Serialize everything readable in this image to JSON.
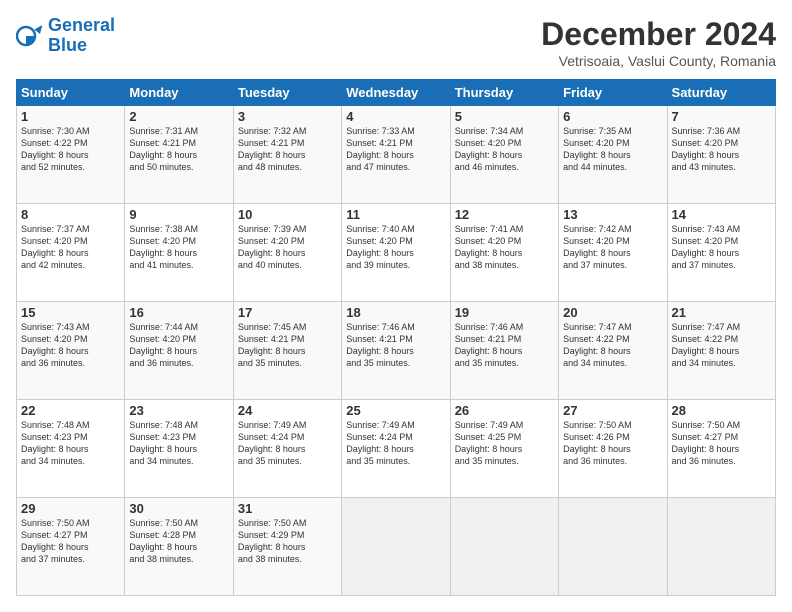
{
  "logo": {
    "line1": "General",
    "line2": "Blue"
  },
  "title": "December 2024",
  "location": "Vetrisoaia, Vaslui County, Romania",
  "days_of_week": [
    "Sunday",
    "Monday",
    "Tuesday",
    "Wednesday",
    "Thursday",
    "Friday",
    "Saturday"
  ],
  "weeks": [
    [
      {
        "day": "1",
        "lines": [
          "Sunrise: 7:30 AM",
          "Sunset: 4:22 PM",
          "Daylight: 8 hours",
          "and 52 minutes."
        ]
      },
      {
        "day": "2",
        "lines": [
          "Sunrise: 7:31 AM",
          "Sunset: 4:21 PM",
          "Daylight: 8 hours",
          "and 50 minutes."
        ]
      },
      {
        "day": "3",
        "lines": [
          "Sunrise: 7:32 AM",
          "Sunset: 4:21 PM",
          "Daylight: 8 hours",
          "and 48 minutes."
        ]
      },
      {
        "day": "4",
        "lines": [
          "Sunrise: 7:33 AM",
          "Sunset: 4:21 PM",
          "Daylight: 8 hours",
          "and 47 minutes."
        ]
      },
      {
        "day": "5",
        "lines": [
          "Sunrise: 7:34 AM",
          "Sunset: 4:20 PM",
          "Daylight: 8 hours",
          "and 46 minutes."
        ]
      },
      {
        "day": "6",
        "lines": [
          "Sunrise: 7:35 AM",
          "Sunset: 4:20 PM",
          "Daylight: 8 hours",
          "and 44 minutes."
        ]
      },
      {
        "day": "7",
        "lines": [
          "Sunrise: 7:36 AM",
          "Sunset: 4:20 PM",
          "Daylight: 8 hours",
          "and 43 minutes."
        ]
      }
    ],
    [
      {
        "day": "8",
        "lines": [
          "Sunrise: 7:37 AM",
          "Sunset: 4:20 PM",
          "Daylight: 8 hours",
          "and 42 minutes."
        ]
      },
      {
        "day": "9",
        "lines": [
          "Sunrise: 7:38 AM",
          "Sunset: 4:20 PM",
          "Daylight: 8 hours",
          "and 41 minutes."
        ]
      },
      {
        "day": "10",
        "lines": [
          "Sunrise: 7:39 AM",
          "Sunset: 4:20 PM",
          "Daylight: 8 hours",
          "and 40 minutes."
        ]
      },
      {
        "day": "11",
        "lines": [
          "Sunrise: 7:40 AM",
          "Sunset: 4:20 PM",
          "Daylight: 8 hours",
          "and 39 minutes."
        ]
      },
      {
        "day": "12",
        "lines": [
          "Sunrise: 7:41 AM",
          "Sunset: 4:20 PM",
          "Daylight: 8 hours",
          "and 38 minutes."
        ]
      },
      {
        "day": "13",
        "lines": [
          "Sunrise: 7:42 AM",
          "Sunset: 4:20 PM",
          "Daylight: 8 hours",
          "and 37 minutes."
        ]
      },
      {
        "day": "14",
        "lines": [
          "Sunrise: 7:43 AM",
          "Sunset: 4:20 PM",
          "Daylight: 8 hours",
          "and 37 minutes."
        ]
      }
    ],
    [
      {
        "day": "15",
        "lines": [
          "Sunrise: 7:43 AM",
          "Sunset: 4:20 PM",
          "Daylight: 8 hours",
          "and 36 minutes."
        ]
      },
      {
        "day": "16",
        "lines": [
          "Sunrise: 7:44 AM",
          "Sunset: 4:20 PM",
          "Daylight: 8 hours",
          "and 36 minutes."
        ]
      },
      {
        "day": "17",
        "lines": [
          "Sunrise: 7:45 AM",
          "Sunset: 4:21 PM",
          "Daylight: 8 hours",
          "and 35 minutes."
        ]
      },
      {
        "day": "18",
        "lines": [
          "Sunrise: 7:46 AM",
          "Sunset: 4:21 PM",
          "Daylight: 8 hours",
          "and 35 minutes."
        ]
      },
      {
        "day": "19",
        "lines": [
          "Sunrise: 7:46 AM",
          "Sunset: 4:21 PM",
          "Daylight: 8 hours",
          "and 35 minutes."
        ]
      },
      {
        "day": "20",
        "lines": [
          "Sunrise: 7:47 AM",
          "Sunset: 4:22 PM",
          "Daylight: 8 hours",
          "and 34 minutes."
        ]
      },
      {
        "day": "21",
        "lines": [
          "Sunrise: 7:47 AM",
          "Sunset: 4:22 PM",
          "Daylight: 8 hours",
          "and 34 minutes."
        ]
      }
    ],
    [
      {
        "day": "22",
        "lines": [
          "Sunrise: 7:48 AM",
          "Sunset: 4:23 PM",
          "Daylight: 8 hours",
          "and 34 minutes."
        ]
      },
      {
        "day": "23",
        "lines": [
          "Sunrise: 7:48 AM",
          "Sunset: 4:23 PM",
          "Daylight: 8 hours",
          "and 34 minutes."
        ]
      },
      {
        "day": "24",
        "lines": [
          "Sunrise: 7:49 AM",
          "Sunset: 4:24 PM",
          "Daylight: 8 hours",
          "and 35 minutes."
        ]
      },
      {
        "day": "25",
        "lines": [
          "Sunrise: 7:49 AM",
          "Sunset: 4:24 PM",
          "Daylight: 8 hours",
          "and 35 minutes."
        ]
      },
      {
        "day": "26",
        "lines": [
          "Sunrise: 7:49 AM",
          "Sunset: 4:25 PM",
          "Daylight: 8 hours",
          "and 35 minutes."
        ]
      },
      {
        "day": "27",
        "lines": [
          "Sunrise: 7:50 AM",
          "Sunset: 4:26 PM",
          "Daylight: 8 hours",
          "and 36 minutes."
        ]
      },
      {
        "day": "28",
        "lines": [
          "Sunrise: 7:50 AM",
          "Sunset: 4:27 PM",
          "Daylight: 8 hours",
          "and 36 minutes."
        ]
      }
    ],
    [
      {
        "day": "29",
        "lines": [
          "Sunrise: 7:50 AM",
          "Sunset: 4:27 PM",
          "Daylight: 8 hours",
          "and 37 minutes."
        ]
      },
      {
        "day": "30",
        "lines": [
          "Sunrise: 7:50 AM",
          "Sunset: 4:28 PM",
          "Daylight: 8 hours",
          "and 38 minutes."
        ]
      },
      {
        "day": "31",
        "lines": [
          "Sunrise: 7:50 AM",
          "Sunset: 4:29 PM",
          "Daylight: 8 hours",
          "and 38 minutes."
        ]
      },
      null,
      null,
      null,
      null
    ]
  ]
}
